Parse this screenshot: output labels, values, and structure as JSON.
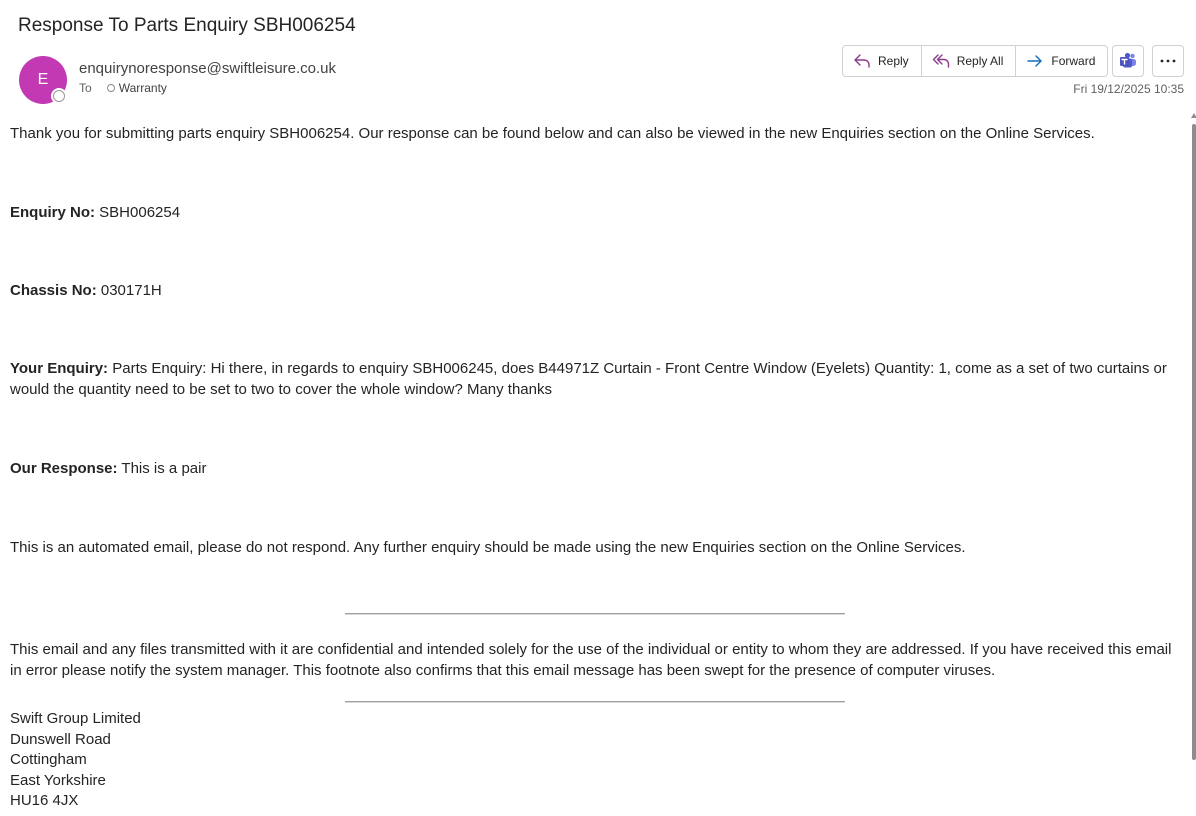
{
  "email": {
    "subject": "Response To Parts Enquiry SBH006254",
    "avatar_initial": "E",
    "avatar_color": "#c239b3",
    "sender": "enquirynoresponse@swiftleisure.co.uk",
    "to_label": "To",
    "recipient": "Warranty",
    "date": "Fri 19/12/2025 10:35"
  },
  "actions": {
    "reply": "Reply",
    "reply_all": "Reply All",
    "forward": "Forward",
    "teams_icon": "teams-icon",
    "more_icon": "more-icon"
  },
  "body": {
    "intro": "Thank you for submitting parts enquiry SBH006254. Our response can be found below and can also be viewed in the new Enquiries section on the Online Services.",
    "enquiry_no_label": "Enquiry No:",
    "enquiry_no": " SBH006254",
    "chassis_no_label": "Chassis No:",
    "chassis_no": " 030171H",
    "your_enquiry_label": "Your Enquiry:",
    "your_enquiry": " Parts Enquiry: Hi there, in regards to enquiry SBH006245, does B44971Z Curtain - Front Centre Window (Eyelets) Quantity: 1, come as a set of two curtains or would the quantity need to be set to two to cover the whole window? Many thanks",
    "our_response_label": "Our Response:",
    "our_response": " This is a pair",
    "automated_note": "This is an automated email, please do not respond. Any further enquiry should be made using the new Enquiries section on the Online Services.",
    "confidential_note": "This email and any files transmitted with it are confidential and intended solely for the use of the individual or entity to whom they are addressed. If you have received this email in error please notify the system manager. This footnote also confirms that this email message has been swept for the presence of computer viruses.",
    "address": [
      "Swift Group Limited",
      "Dunswell Road",
      "Cottingham",
      "East Yorkshire",
      "HU16 4JX"
    ]
  },
  "colors": {
    "reply_icon": "#8b3a8b",
    "forward_icon": "#0f6cbd",
    "teams_icon": "#5059c9"
  }
}
